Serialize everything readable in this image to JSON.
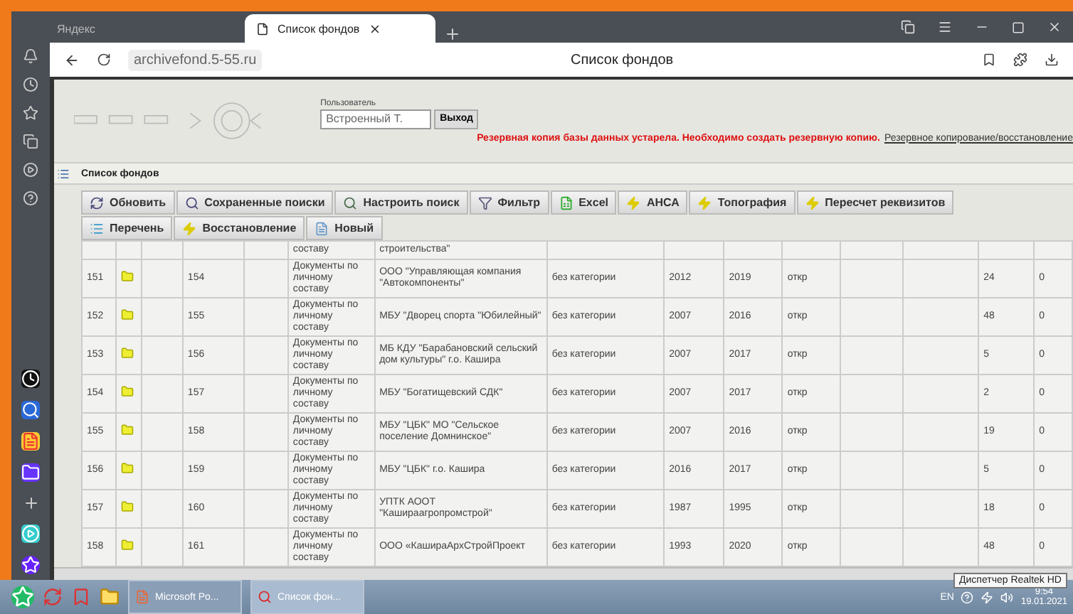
{
  "browser": {
    "tabs": [
      {
        "label": "Яндекс",
        "selected": false
      },
      {
        "label": "Список фондов",
        "selected": true
      }
    ],
    "address": "archivefond.5-55.ru",
    "page_title": "Список фондов"
  },
  "header": {
    "user_label": "Пользователь",
    "user_value": "Встроенный Т.",
    "logout": "Выход",
    "warning": "Резервная копия базы данных устарела. Необходимо создать резервную копию.",
    "backup_link": "Резервное копирование/восстановление"
  },
  "section_title": "Список фондов",
  "toolbar": [
    [
      {
        "label": "Обновить",
        "kind": "refresh"
      },
      {
        "label": "Сохраненные поиски",
        "kind": "saved"
      },
      {
        "label": "Настроить поиск",
        "kind": "settings"
      },
      {
        "label": "Фильтр",
        "kind": "filter"
      },
      {
        "label": "Excel",
        "kind": "excel"
      },
      {
        "label": "АНСА",
        "kind": "bolt"
      },
      {
        "label": "Топография",
        "kind": "bolt"
      },
      {
        "label": "Пересчет реквизитов",
        "kind": "bolt"
      }
    ],
    [
      {
        "label": "Перечень",
        "kind": "list"
      },
      {
        "label": "Восстановление",
        "kind": "bolt"
      },
      {
        "label": "Новый",
        "kind": "doc"
      }
    ]
  ],
  "table": {
    "clipped_row": {
      "type": "составу",
      "name": "строительства\""
    },
    "rows": [
      {
        "n": "151",
        "fond": "154",
        "type": "Документы по личному составу",
        "name": "ООО \"Управляющая компания \"Автокомпоненты\"",
        "category": "без категории",
        "start": "2012",
        "end": "2019",
        "access": "откр",
        "count": "24",
        "extra": "0"
      },
      {
        "n": "152",
        "fond": "155",
        "type": "Документы по личному составу",
        "name": "МБУ \"Дворец спорта \"Юбилейный\"",
        "category": "без категории",
        "start": "2007",
        "end": "2016",
        "access": "откр",
        "count": "48",
        "extra": "0"
      },
      {
        "n": "153",
        "fond": "156",
        "type": "Документы по личному составу",
        "name": "МБ КДУ \"Барабановский сельский дом культуры\" г.о. Кашира",
        "category": "без категории",
        "start": "2007",
        "end": "2017",
        "access": "откр",
        "count": "5",
        "extra": "0"
      },
      {
        "n": "154",
        "fond": "157",
        "type": "Документы по личному составу",
        "name": "МБУ \"Богатищевский СДК\"",
        "category": "без категории",
        "start": "2007",
        "end": "2017",
        "access": "откр",
        "count": "2",
        "extra": "0"
      },
      {
        "n": "155",
        "fond": "158",
        "type": "Документы по личному составу",
        "name": "МБУ \"ЦБК\" МО \"Сельское поселение Домнинское\"",
        "category": "без категории",
        "start": "2007",
        "end": "2016",
        "access": "откр",
        "count": "19",
        "extra": "0"
      },
      {
        "n": "156",
        "fond": "159",
        "type": "Документы по личному составу",
        "name": "МБУ \"ЦБК\" г.о. Кашира",
        "category": "без категории",
        "start": "2016",
        "end": "2017",
        "access": "откр",
        "count": "5",
        "extra": "0"
      },
      {
        "n": "157",
        "fond": "160",
        "type": "Документы по личному составу",
        "name": "УПТК АООТ \"Кашираагропромстрой\"",
        "category": "без категории",
        "start": "1987",
        "end": "1995",
        "access": "откр",
        "count": "18",
        "extra": "0"
      },
      {
        "n": "158",
        "fond": "161",
        "type": "Документы по личному составу",
        "name": "ООО «КаширaАрхСтройПроект",
        "category": "без категории",
        "start": "1993",
        "end": "2020",
        "access": "откр",
        "count": "48",
        "extra": "0"
      }
    ]
  },
  "taskbar": {
    "apps": [
      {
        "label": "Microsoft Po...",
        "selected": false
      },
      {
        "label": "Список фон...",
        "selected": true
      }
    ],
    "lang": "EN",
    "time": "9:54",
    "date": "19.01.2021",
    "tooltip": "Диспетчер Realtek HD"
  }
}
